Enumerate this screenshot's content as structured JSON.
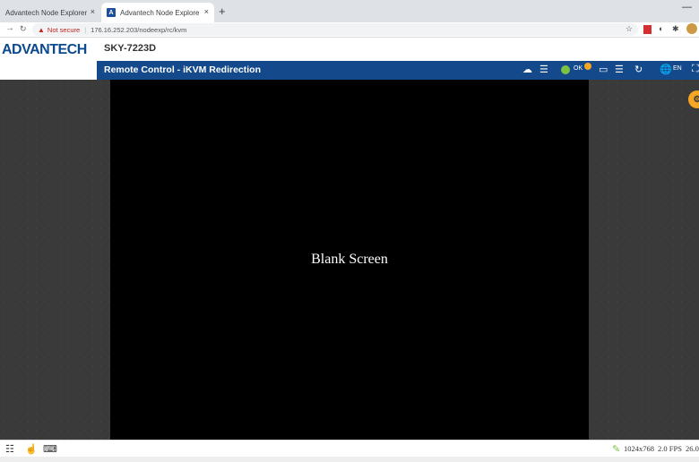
{
  "browser": {
    "tabs": [
      {
        "title": "Advantech Node Explorer",
        "close": "×"
      },
      {
        "title": "Advantech Node Explorer - iKVM",
        "close": "×",
        "favicon": "A"
      }
    ],
    "new_tab": "+",
    "window_minimize": "—",
    "nav": {
      "back": "←",
      "forward": "→",
      "reload": "C"
    },
    "address": {
      "warning": "▲",
      "security_label": "Not secure",
      "separator": "|",
      "url": "176.16.252.203/nodeexp/rc/kvm",
      "star": "☆"
    }
  },
  "header": {
    "logo": "ADVANTECH",
    "model": "SKY-7223D"
  },
  "titlebar": {
    "title": "Remote Control - iKVM Redirection",
    "ok_label": "OK",
    "lang_label": "EN",
    "colors": {
      "bar": "#144a8b",
      "badge": "#f5a623"
    }
  },
  "kvm": {
    "screen_text": "Blank Screen"
  },
  "footer": {
    "resolution": "1024x768",
    "fps": "2.0 FPS",
    "extra": "26.0"
  }
}
